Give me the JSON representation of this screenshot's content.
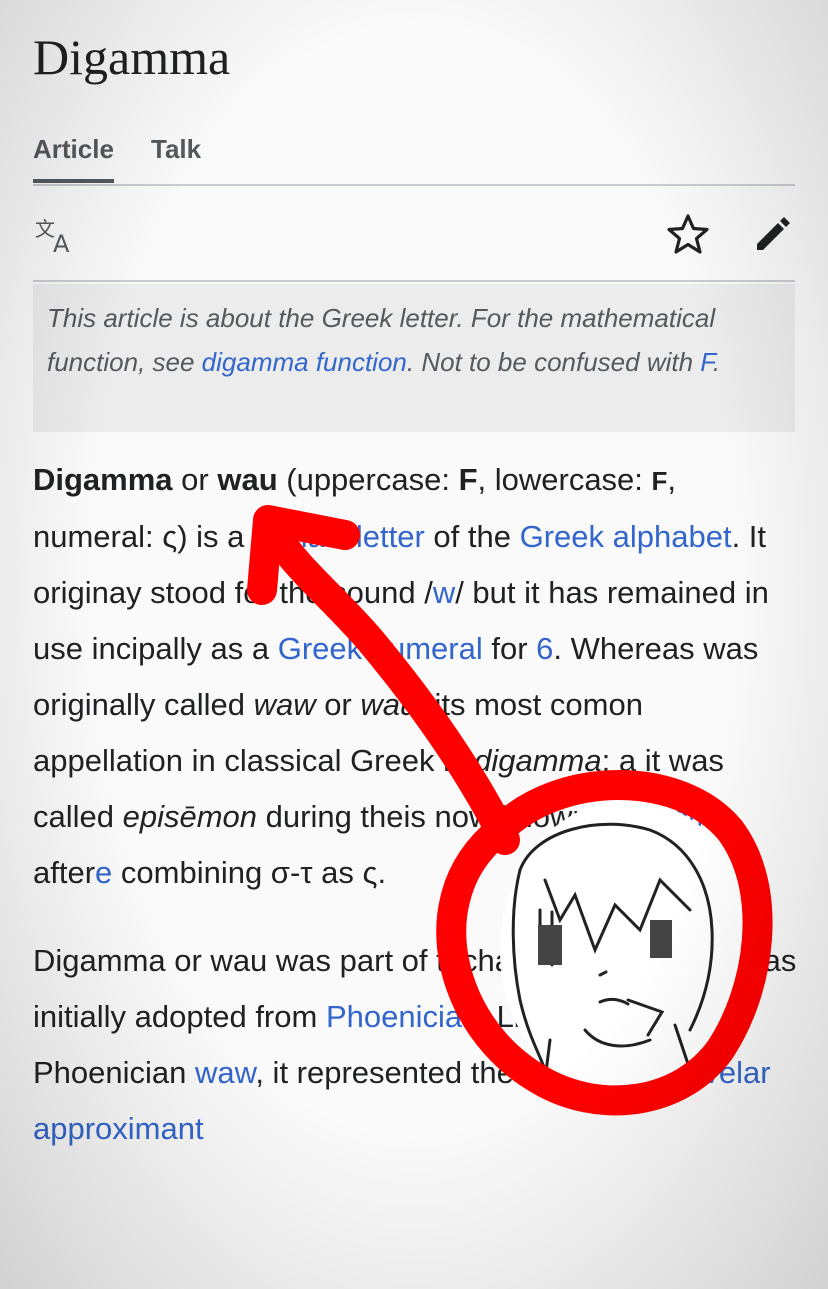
{
  "page": {
    "title": "Digamma"
  },
  "tabs": [
    {
      "label": "Article",
      "active": true
    },
    {
      "label": "Talk",
      "active": false
    }
  ],
  "toolbar": {
    "icons": [
      "language-icon",
      "star-icon",
      "edit-pencil-icon"
    ]
  },
  "hatnote": {
    "t1": "This article is about the Greek letter. For the mathematical function, see ",
    "link1": "digamma function",
    "t2": ". Not to be confused with ",
    "link2": "F",
    "t3": "."
  },
  "paragraph1": {
    "b1": "Digamma",
    "t1": " or ",
    "b2": "wau",
    "t2": " (uppercase: ",
    "b3": "F",
    "t3": ", lowercase: ",
    "b4": "F",
    "t4": ", numeral: ",
    "sym1": "ς",
    "t5": ") is a",
    "link1": "haic letter",
    "t6": " of the ",
    "link2": "Greek alphabet",
    "t7": ". It origina",
    "t8": "y stood for the sound /",
    "link3": "w",
    "t9": "/ but it has remained in use ",
    "t10": "incipally as a ",
    "link4": "Greek numeral",
    "t11": " for ",
    "link5": "6",
    "t12": ". Whereas ",
    "t13": "was originally called ",
    "i1": "waw",
    "t14": " or ",
    "i2": "wau",
    "t15": ", its most com",
    "t16": "on appellation in classical Greek is ",
    "i3": "digamma",
    "t17": "; a",
    "t18": " it was called ",
    "i4": "episēmon",
    "t19": " during the",
    "t20": "is now known as ",
    "link6": "stigma",
    "t21": " after",
    "link7": "e",
    "t22": " combining σ-τ as ",
    "sym2": "ς",
    "t23": "."
  },
  "paragraph2": {
    "t1": "Digamma or wau was part of th",
    "t2": "chaic Greek alphabet as initially adopted from ",
    "link1": "Phoenician",
    "t3": ". Like its model, Phoenician ",
    "link2": "waw",
    "t4": ", it represented the ",
    "link3": "voiced labial-velar approximant"
  },
  "overlay": {
    "annotation_color": "#ff0000",
    "sketch": "drawn anime face sketch inside red circle with arrow"
  }
}
